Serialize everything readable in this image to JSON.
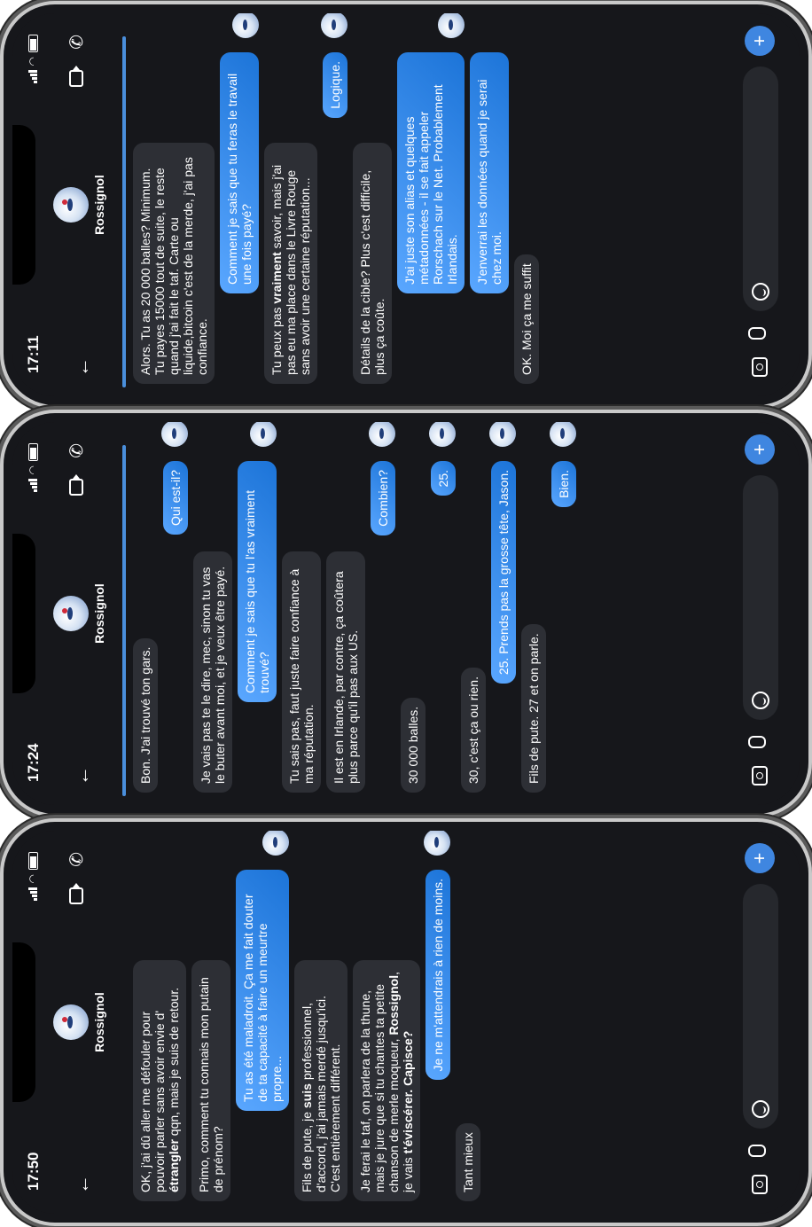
{
  "panels": [
    {
      "time": "17:11",
      "contact": "Rossignol",
      "progress": 0.96,
      "messages": [
        {
          "dir": "in",
          "text": "Alors. Tu as 20 000 balles? Minimum. Tu payes 15000 tout de suite, le reste quand j'ai fait le taf. Carte ou liquide,bitcoin c'est de la merde, j'ai pas confiance."
        },
        {
          "dir": "out",
          "text": "Comment je sais que tu feras le travail une fois payé?"
        },
        {
          "dir": "in",
          "text_html": "Tu peux pas <b>vraiment</b> savoir, mais j'ai pas eu ma place dans le Livre Rouge sans avoir une certaine réputation..."
        },
        {
          "dir": "out",
          "text": "Logique."
        },
        {
          "dir": "in",
          "text": "Détails de la cible? Plus c'est difficile, plus ça coûte."
        },
        {
          "dir": "out",
          "text": "J'ai juste son alias et quelques métadonnées - il se fait appeler Rorschach sur le Net. Probablement Irlandais."
        },
        {
          "dir": "out",
          "text": "J'enverrai les données quand je serai chez moi."
        },
        {
          "dir": "in",
          "text": "OK. Moi ça me suffit"
        }
      ]
    },
    {
      "time": "17:24",
      "contact": "Rossignol",
      "progress": 0.96,
      "messages": [
        {
          "dir": "in",
          "text": "Bon. J'ai trouvé ton gars."
        },
        {
          "dir": "out",
          "text": "Qui est-il?"
        },
        {
          "dir": "in",
          "text": "Je vais pas te le dire, mec, sinon tu vas le buter avant moi, et je veux être payé."
        },
        {
          "dir": "out",
          "text": "Comment je sais que tu l'as vraiment trouvé?"
        },
        {
          "dir": "in",
          "text": "Tu sais pas, faut juste faire confiance à ma réputation."
        },
        {
          "dir": "in",
          "text": "Il est en Irlande, par contre, ça coûtera plus parce qu'il pas aux US."
        },
        {
          "dir": "out",
          "text": "Combien?"
        },
        {
          "dir": "in",
          "text": "30 000 balles."
        },
        {
          "dir": "out",
          "text": "25."
        },
        {
          "dir": "in",
          "text": "30, c'est ça ou rien."
        },
        {
          "dir": "out",
          "text": "25. Prends pas la grosse tête, Jason."
        },
        {
          "dir": "in",
          "text": "Fils de pute. 27 et on parle."
        },
        {
          "dir": "out",
          "text": "Bien."
        }
      ]
    },
    {
      "time": "17:50",
      "contact": "Rossignol",
      "progress": 0,
      "messages": [
        {
          "dir": "in",
          "text_html": "OK, j'ai dû aller me défouler pour pouvoir parler sans avoir envie d' <b>étrangler</b> qqn, mais je suis de retour."
        },
        {
          "dir": "in",
          "text": "Primo, comment tu connais mon putain de prénom?"
        },
        {
          "dir": "out",
          "text": "Tu as été maladroit. Ça me fait douter de ta capacité à faire un meurtre propre..."
        },
        {
          "dir": "in",
          "text_html": "Fils de pute, je <b>suis</b> professionnel, d'accord, j'ai jamais merdé jusqu'ici. C'est entièrement différent."
        },
        {
          "dir": "in",
          "text_html": "Je ferai le taf, on parlera de la thune, mais je jure que si tu chantes ta petite chanson de merle moqueur, <b>Rossignol</b>, je vais <b>t'éviscérer. Capisce?</b>"
        },
        {
          "dir": "out",
          "text": "Je ne m'attendrais à rien de moins."
        },
        {
          "dir": "in",
          "text": "Tant mieux"
        }
      ]
    }
  ]
}
